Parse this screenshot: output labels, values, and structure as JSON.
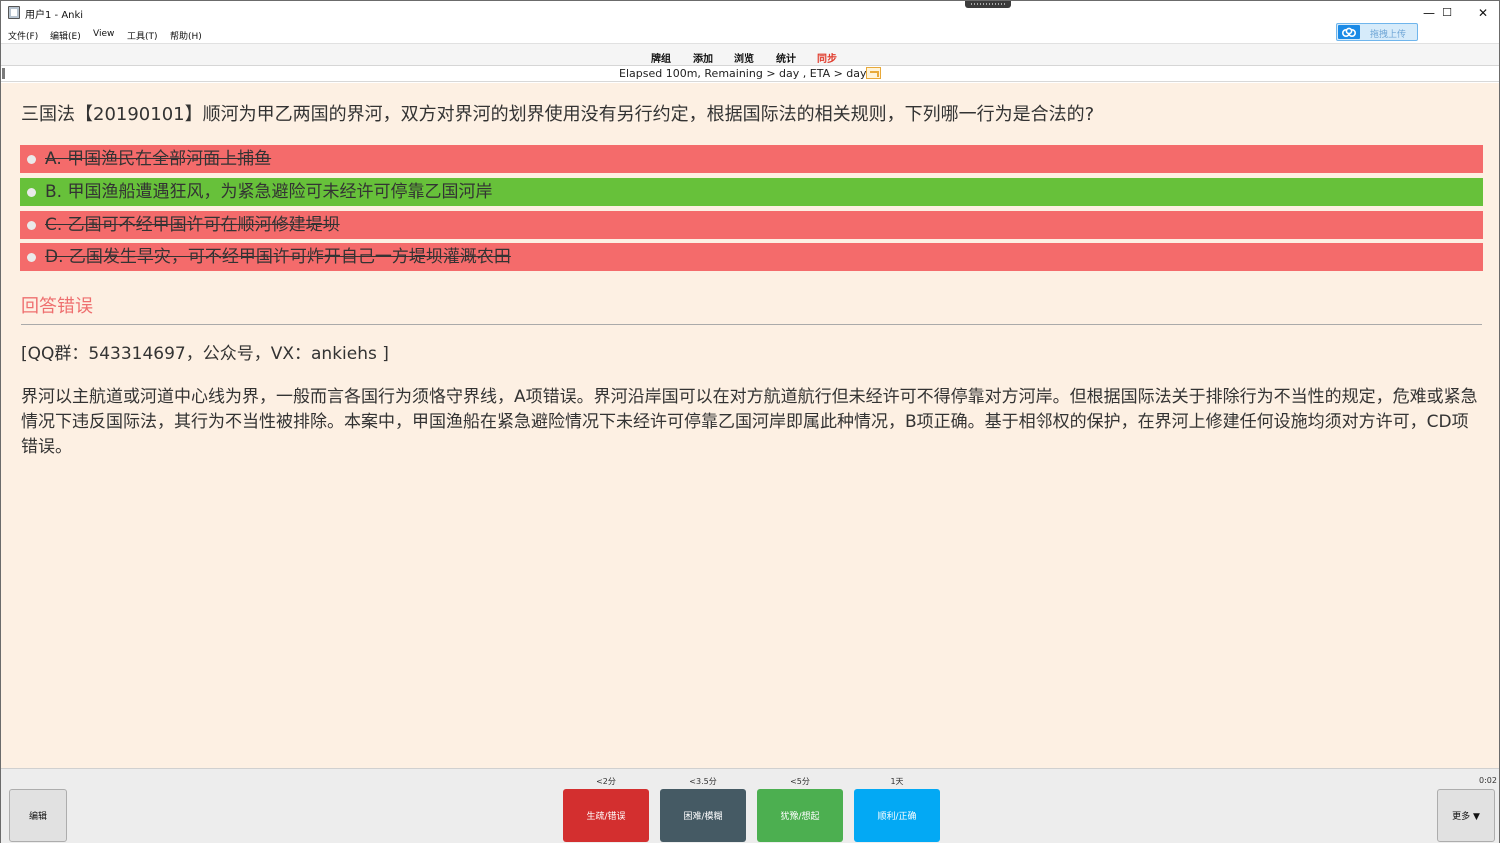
{
  "window": {
    "title": "用户1 - Anki",
    "controls": {
      "minimize": "—",
      "maximize": "☐",
      "close": "✕"
    }
  },
  "menu": [
    "文件(F)",
    "编辑(E)",
    "View",
    "工具(T)",
    "帮助(H)"
  ],
  "upload": {
    "label": "拖拽上传",
    "icon": "cloud-icon",
    "color": "#1b8ae6"
  },
  "toolbar": {
    "items": [
      {
        "label": "牌组"
      },
      {
        "label": "添加"
      },
      {
        "label": "浏览"
      },
      {
        "label": "统计"
      },
      {
        "label": "同步",
        "color": "#e03b2c"
      }
    ]
  },
  "status": {
    "text": "Elapsed 100m, Remaining > day , ETA > day"
  },
  "card": {
    "background": "#fdf0e3",
    "question": "三国法【20190101】顺河为甲乙两国的界河，双方对界河的划界使用没有另行约定，根据国际法的相关规则，下列哪一行为是合法的?",
    "options": [
      {
        "text": "A. 甲国渔民在全部河面上捕鱼",
        "state": "wrong"
      },
      {
        "text": "B. 甲国渔船遭遇狂风，为紧急避险可未经许可停靠乙国河岸",
        "state": "correct"
      },
      {
        "text": "C. 乙国可不经甲国许可在顺河修建堤坝",
        "state": "wrong"
      },
      {
        "text": "D. 乙国发生旱灾，可不经甲国许可炸开自己一方堤坝灌溉农田",
        "state": "wrong"
      }
    ],
    "verdict": "回答错误",
    "info": "[QQ群：543314697，公众号，VX：ankiehs ]",
    "explanation": "界河以主航道或河道中心线为界，一般而言各国行为须恪守界线，A项错误。界河沿岸国可以在对方航道航行但未经许可不得停靠对方河岸。但根据国际法关于排除行为不当性的规定，危难或紧急情况下违反国际法，其行为不当性被排除。本案中，甲国渔船在紧急避险情况下未经许可停靠乙国河岸即属此种情况，B项正确。基于相邻权的保护，在界河上修建任何设施均须对方许可，CD项错误。"
  },
  "colors": {
    "wrong": "#f46b6b",
    "correct": "#67c13a",
    "verdict": "#ee6f6f"
  },
  "bottom": {
    "edit": "编辑",
    "more": "更多 ▼",
    "timer": "0:02",
    "answers": [
      {
        "interval": "<2分",
        "label": "生疏/错误",
        "color": "#d32f2f"
      },
      {
        "interval": "<3.5分",
        "label": "困难/模糊",
        "color": "#455a64"
      },
      {
        "interval": "<5分",
        "label": "犹豫/想起",
        "color": "#4caf50"
      },
      {
        "interval": "1天",
        "label": "顺利/正确",
        "color": "#03a9f4"
      }
    ]
  }
}
